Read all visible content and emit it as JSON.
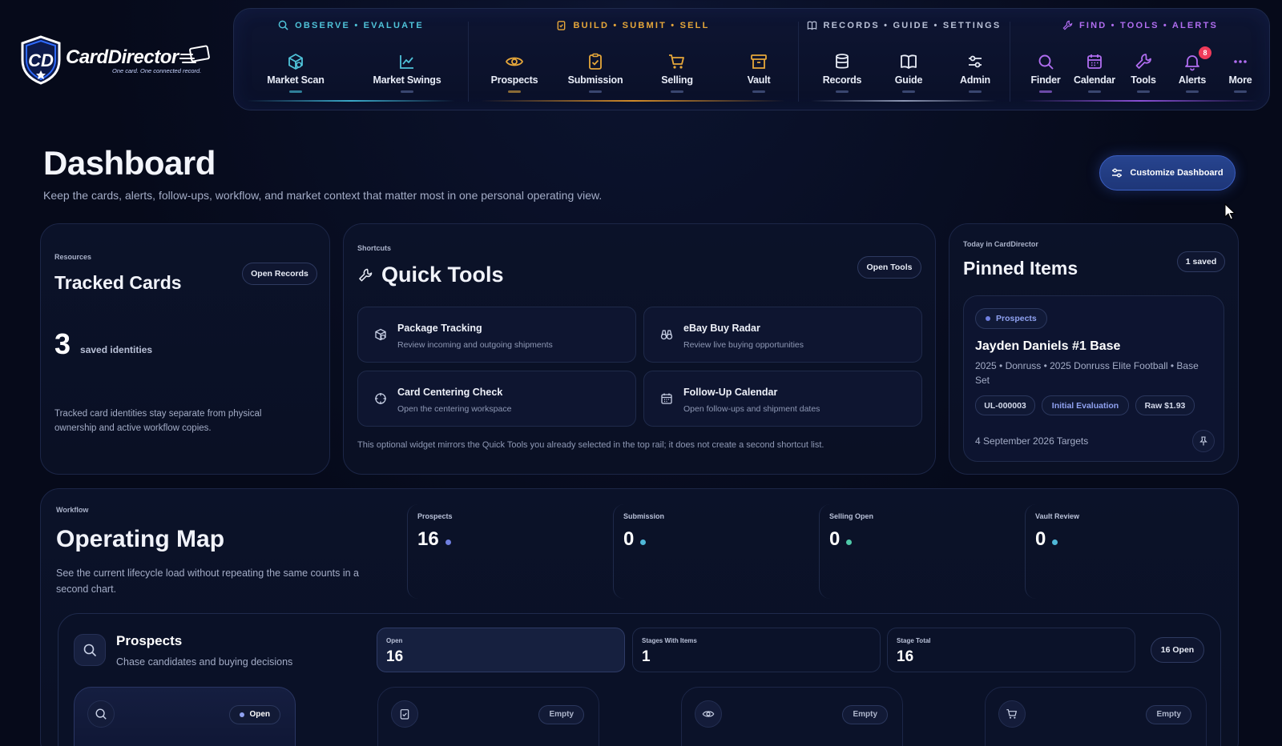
{
  "brand": {
    "name": "CardDirector",
    "tagline": "One card. One connected record."
  },
  "nav": {
    "groups": [
      {
        "heading": "OBSERVE • EVALUATE",
        "color": "#4fc3d9"
      },
      {
        "heading": "BUILD • SUBMIT • SELL",
        "color": "#e6a73a"
      },
      {
        "heading": "RECORDS • GUIDE • SETTINGS",
        "color": "#b8c0d6"
      },
      {
        "heading": "FIND • TOOLS • ALERTS",
        "color": "#b06df0"
      }
    ],
    "items": [
      {
        "label": "Market Scan",
        "icon": "radar-cube-icon"
      },
      {
        "label": "Market Swings",
        "icon": "line-chart-icon"
      },
      {
        "label": "Prospects",
        "icon": "eye-icon"
      },
      {
        "label": "Submission",
        "icon": "clipboard-check-icon"
      },
      {
        "label": "Selling",
        "icon": "cart-icon"
      },
      {
        "label": "Vault",
        "icon": "archive-icon"
      },
      {
        "label": "Records",
        "icon": "database-icon"
      },
      {
        "label": "Guide",
        "icon": "book-icon"
      },
      {
        "label": "Admin",
        "icon": "sliders-icon"
      },
      {
        "label": "Finder",
        "icon": "search-icon"
      },
      {
        "label": "Calendar",
        "icon": "calendar-icon"
      },
      {
        "label": "Tools",
        "icon": "wrench-icon"
      },
      {
        "label": "Alerts",
        "icon": "bell-icon",
        "badge": "8"
      },
      {
        "label": "More",
        "icon": "ellipsis-icon"
      }
    ]
  },
  "page": {
    "title": "Dashboard",
    "subtitle": "Keep the cards, alerts, follow-ups, workflow, and market context that matter most in one personal operating view.",
    "customize_label": "Customize Dashboard"
  },
  "tracked": {
    "eyebrow": "Resources",
    "title": "Tracked Cards",
    "button": "Open Records",
    "count": "3",
    "count_label": "saved identities",
    "note": "Tracked card identities stay separate from physical ownership and active workflow copies."
  },
  "quick_tools": {
    "eyebrow": "Shortcuts",
    "title": "Quick Tools",
    "button": "Open Tools",
    "tools": [
      {
        "name": "Package Tracking",
        "desc": "Review incoming and outgoing shipments",
        "icon": "package-icon"
      },
      {
        "name": "eBay Buy Radar",
        "desc": "Review live buying opportunities",
        "icon": "binoculars-icon"
      },
      {
        "name": "Card Centering Check",
        "desc": "Open the centering workspace",
        "icon": "crosshair-icon"
      },
      {
        "name": "Follow-Up Calendar",
        "desc": "Open follow-ups and shipment dates",
        "icon": "calendar-icon"
      }
    ],
    "note": "This optional widget mirrors the Quick Tools you already selected in the top rail; it does not create a second shortcut list."
  },
  "pinned": {
    "eyebrow": "Today in CardDirector",
    "title": "Pinned Items",
    "saved": "1 saved",
    "item": {
      "stage": "Prospects",
      "name": "Jayden Daniels #1 Base",
      "details": "2025 • Donruss • 2025 Donruss Elite Football • Base Set",
      "tags": [
        "UL-000003",
        "Initial Evaluation",
        "Raw $1.93"
      ],
      "footer": "4 September 2026 Targets"
    }
  },
  "operating": {
    "eyebrow": "Workflow",
    "title": "Operating Map",
    "subtitle": "See the current lifecycle load without repeating the same counts in a second chart.",
    "stats": [
      {
        "label": "Prospects",
        "value": "16",
        "dot": "#6f7fe0"
      },
      {
        "label": "Submission",
        "value": "0",
        "dot": "#4fb8d8"
      },
      {
        "label": "Selling Open",
        "value": "0",
        "dot": "#4fc9a8"
      },
      {
        "label": "Vault Review",
        "value": "0",
        "dot": "#4fb8d8"
      }
    ]
  },
  "prospects_panel": {
    "title": "Prospects",
    "subtitle": "Chase candidates and buying decisions",
    "metrics": [
      {
        "label": "Open",
        "value": "16"
      },
      {
        "label": "Stages With Items",
        "value": "1"
      },
      {
        "label": "Stage Total",
        "value": "16"
      }
    ],
    "open_pill": "16 Open",
    "stages": [
      {
        "pill": "Open",
        "icon": "search-icon"
      },
      {
        "pill": "Empty",
        "icon": "clipboard-check-icon"
      },
      {
        "pill": "Empty",
        "icon": "eye-icon"
      },
      {
        "pill": "Empty",
        "icon": "cart-icon"
      }
    ]
  }
}
